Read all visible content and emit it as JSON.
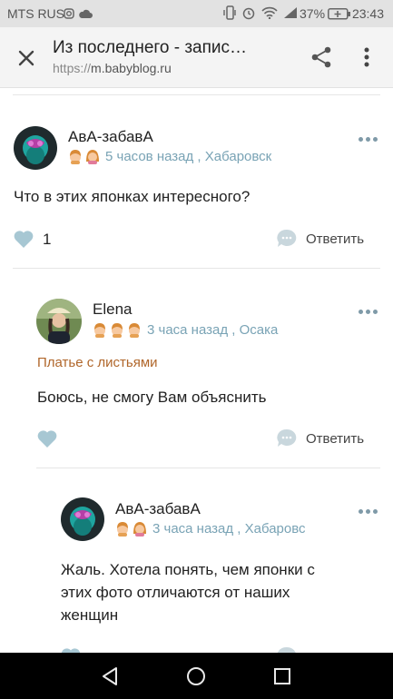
{
  "status_bar": {
    "carrier": "MTS RUS",
    "battery": "37%",
    "time": "23:43"
  },
  "toolbar": {
    "title": "Из последнего - запис…",
    "url_scheme": "https://",
    "url_host": "m.babyblog.ru"
  },
  "comments": [
    {
      "author": "АвА-забавА",
      "time": "5 часов назад",
      "location": "Хабаровск",
      "badges": [
        "boy-icon",
        "girl-icon"
      ],
      "text": "Что в этих японках интересного?",
      "likes": "1",
      "reply_label": "Ответить"
    },
    {
      "author": "Elena",
      "time": "3 часа назад",
      "location": "Осака",
      "badges": [
        "boy-icon",
        "boy-icon",
        "boy-icon"
      ],
      "topic": "Платье с листьями",
      "text": "Боюсь, не смогу Вам объяснить",
      "reply_label": "Ответить"
    },
    {
      "author": "АвА-забавА",
      "time": "3 часа назад",
      "location": "Хабаровс",
      "badges": [
        "boy-icon",
        "girl-icon"
      ],
      "text_lines": [
        "Жаль. Хотела понять, чем японки с",
        "этих фото отличаются от наших",
        "женщин"
      ]
    }
  ],
  "colors": {
    "meta_text": "#79a3b5",
    "topic_link": "#b0662a",
    "like_heart": "#a7c7d3"
  }
}
